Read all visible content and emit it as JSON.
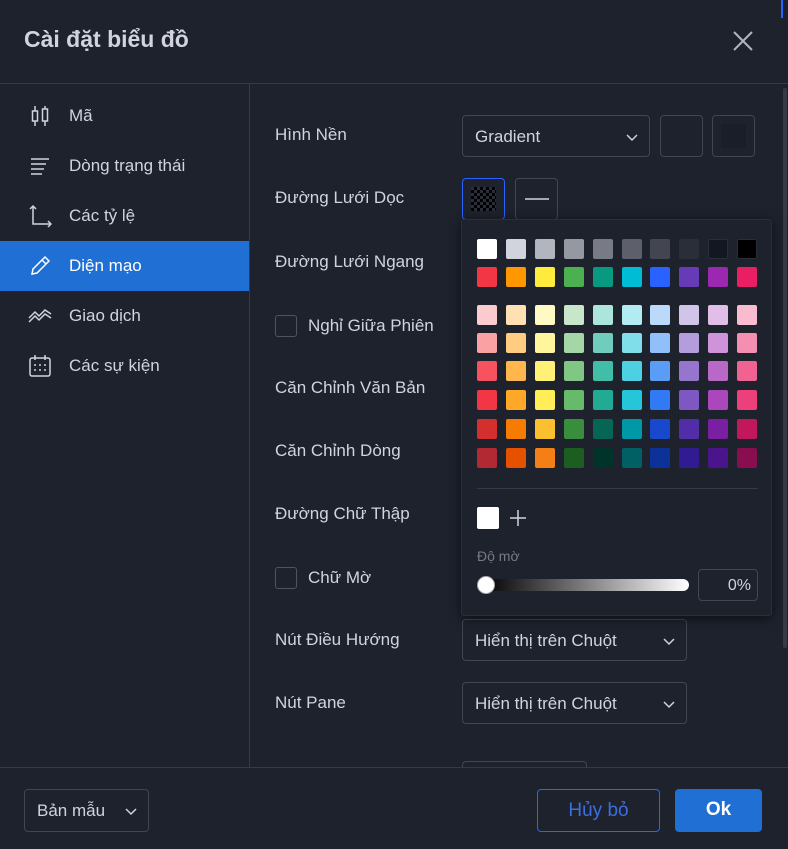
{
  "dialog": {
    "title": "Cài đặt biểu đồ",
    "close_icon": "close-icon"
  },
  "sidebar": {
    "items": [
      {
        "label": "Mã",
        "icon": "candlestick-icon",
        "active": false
      },
      {
        "label": "Dòng trạng thái",
        "icon": "status-line-icon",
        "active": false
      },
      {
        "label": "Các tỷ lệ",
        "icon": "scales-icon",
        "active": false
      },
      {
        "label": "Diện mạo",
        "icon": "pencil-icon",
        "active": true
      },
      {
        "label": "Giao dịch",
        "icon": "trading-icon",
        "active": false
      },
      {
        "label": "Các sự kiện",
        "icon": "calendar-icon",
        "active": false
      }
    ]
  },
  "content": {
    "background": {
      "label": "Hình Nền",
      "value": "Gradient"
    },
    "vert_grid": {
      "label": "Đường Lưới Dọc"
    },
    "horz_grid": {
      "label": "Đường Lưới Ngang"
    },
    "session_breaks": {
      "label": "Nghỉ Giữa Phiên",
      "checked": false
    },
    "scales_text": {
      "label": "Căn Chỉnh Văn Bản"
    },
    "scales_lines": {
      "label": "Căn Chỉnh Dòng"
    },
    "crosshair": {
      "label": "Đường Chữ Thập"
    },
    "watermark": {
      "label": "Chữ Mờ",
      "checked": false
    },
    "nav_buttons": {
      "label": "Nút Điều Hướng",
      "value": "Hiển thị trên Chuột"
    },
    "pane_buttons": {
      "label": "Nút Pane",
      "value": "Hiển thị trên Chuột"
    }
  },
  "color_picker": {
    "palette_rows": [
      [
        "#ffffff",
        "#d1d4dc",
        "#b2b5be",
        "#9598a1",
        "#787b86",
        "#5d606b",
        "#434651",
        "#2a2e39",
        "#131722",
        "#000000"
      ],
      [
        "#f23645",
        "#ff9800",
        "#ffeb3b",
        "#4caf50",
        "#089981",
        "#00bcd4",
        "#2962ff",
        "#673ab7",
        "#9c27b0",
        "#e91e63"
      ],
      [
        "#fccbcd",
        "#ffe0b2",
        "#fff9c4",
        "#c8e6c9",
        "#ace5dc",
        "#b2ebf2",
        "#bbd9fb",
        "#d1c4e9",
        "#e1bee7",
        "#f8bbd0"
      ],
      [
        "#faa1a4",
        "#ffcc80",
        "#fff59d",
        "#a5d6a7",
        "#70ccbd",
        "#80deea",
        "#90bff9",
        "#b39ddb",
        "#ce93d8",
        "#f48fb1"
      ],
      [
        "#f7525f",
        "#ffb74d",
        "#fff176",
        "#81c784",
        "#42bda8",
        "#4dd0e1",
        "#5b9cf6",
        "#9575cd",
        "#ba68c8",
        "#f06292"
      ],
      [
        "#f23645",
        "#ffa726",
        "#ffee58",
        "#66bb6a",
        "#22ab94",
        "#26c6da",
        "#3179f5",
        "#7e57c2",
        "#ab47bc",
        "#ec407a"
      ],
      [
        "#d32f2f",
        "#f57c00",
        "#fbc02d",
        "#388e3c",
        "#056656",
        "#0097a7",
        "#1848cc",
        "#512da8",
        "#7b1fa2",
        "#c2185b"
      ],
      [
        "#b22833",
        "#e65100",
        "#f57f17",
        "#1b5e20",
        "#00332a",
        "#006064",
        "#0c3299",
        "#311b92",
        "#4a148c",
        "#880e4f"
      ]
    ],
    "opacity_label": "Độ mờ",
    "opacity_value": "0%",
    "opacity_level": 0,
    "custom_color": "#ffffff",
    "add_icon": "plus-icon"
  },
  "footer": {
    "template_label": "Bản mẫu",
    "cancel_label": "Hủy bỏ",
    "ok_label": "Ok"
  },
  "colors": {
    "accent": "#2962ff",
    "active_bg": "#1f6fd4",
    "background": "#1e222d"
  }
}
